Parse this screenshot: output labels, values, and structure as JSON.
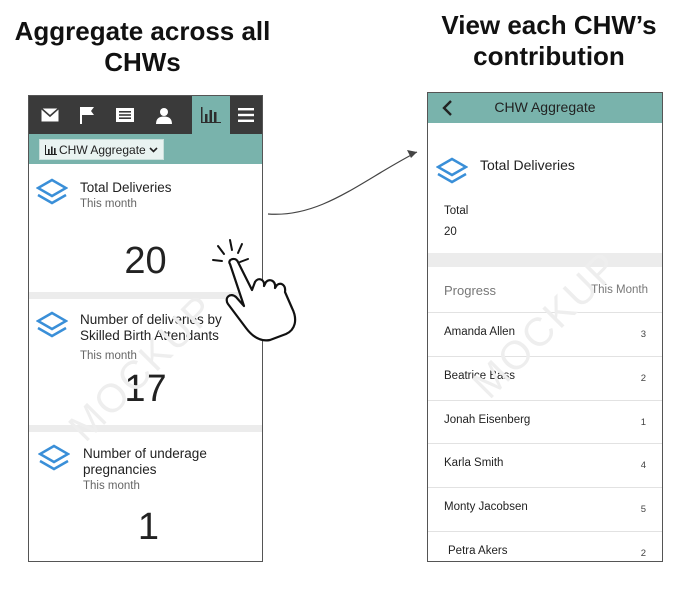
{
  "headings": {
    "left": "Aggregate across all CHWs",
    "right": "View each CHW’s contribution"
  },
  "left_phone": {
    "nav": {
      "icons": [
        "mail-icon",
        "flag-icon",
        "list-icon",
        "person-icon",
        "bar-chart-icon",
        "menu-icon"
      ],
      "active": "bar-chart-icon"
    },
    "dropdown_label": "CHW Aggregate",
    "cards": [
      {
        "title": "Total Deliveries",
        "subtitle": "This month",
        "value": "20"
      },
      {
        "title": "Number of deliveries by Skilled Birth Attendants",
        "subtitle": "This month",
        "value": "17"
      },
      {
        "title": "Number of underage pregnancies",
        "subtitle": "This month",
        "value": "1"
      }
    ],
    "watermark": "MOCKUP"
  },
  "right_phone": {
    "header_title": "CHW Aggregate",
    "card_title": "Total Deliveries",
    "total_label": "Total",
    "total_value": "20",
    "progress_label": "Progress",
    "period_label": "This Month",
    "rows": [
      {
        "name": "Amanda Allen",
        "value": "3"
      },
      {
        "name": "Beatrice Bass",
        "value": "2"
      },
      {
        "name": "Jonah Eisenberg",
        "value": "1"
      },
      {
        "name": "Karla Smith",
        "value": "4"
      },
      {
        "name": "Monty Jacobsen",
        "value": "5"
      },
      {
        "name": "Petra Akers",
        "value": "2"
      }
    ],
    "watermark": "MOCKUP"
  },
  "colors": {
    "teal": "#79b3ac",
    "navbar": "#3a3a3a",
    "icon_blue": "#3a8fd8"
  }
}
